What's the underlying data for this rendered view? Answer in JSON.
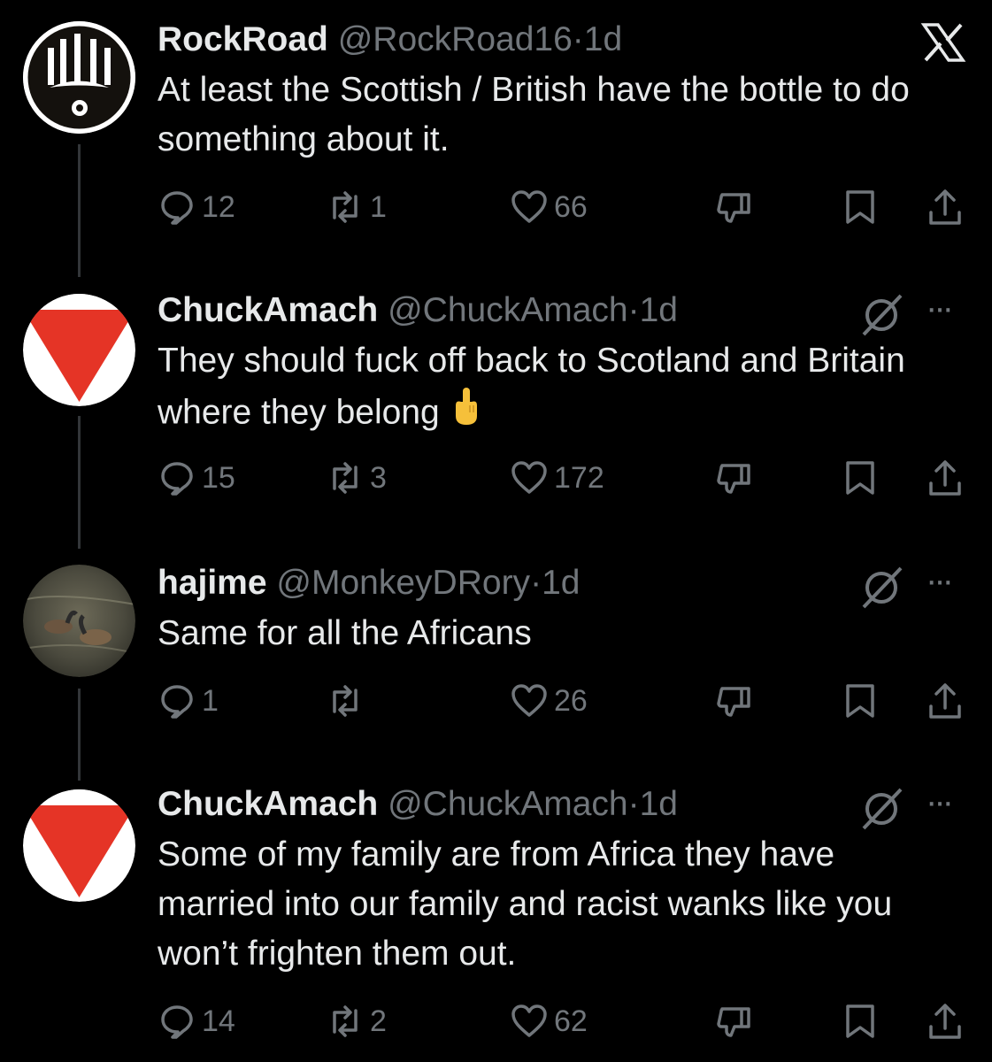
{
  "tweets": [
    {
      "name": "RockRoad",
      "handle": "@RockRoad16",
      "time": "1d",
      "text": "At least the Scottish / British have the bottle to do something about it.",
      "replies": "12",
      "reposts": "1",
      "likes": "66"
    },
    {
      "name": "ChuckAmach",
      "handle": "@ChuckAmach",
      "time": "1d",
      "text": "They should fuck off back to Scotland and Britain where they belong",
      "replies": "15",
      "reposts": "3",
      "likes": "172"
    },
    {
      "name": "hajime",
      "handle": "@MonkeyDRory",
      "time": "1d",
      "text": "Same for all the Africans",
      "replies": "1",
      "reposts": "",
      "likes": "26"
    },
    {
      "name": "ChuckAmach",
      "handle": "@ChuckAmach",
      "time": "1d",
      "text": "Some of my family are from Africa they have married into our family and racist wanks like you won’t frighten them out.",
      "replies": "14",
      "reposts": "2",
      "likes": "62"
    }
  ],
  "ui": {
    "separator": "·",
    "more_label": "···",
    "top_icon": "x-logo-icon",
    "muted_icon": "grok-icon"
  },
  "colors": {
    "background": "#000000",
    "text": "#e7e9ea",
    "secondary": "#71767b",
    "thread_line": "#333639",
    "avatar_red": "#e53426"
  }
}
